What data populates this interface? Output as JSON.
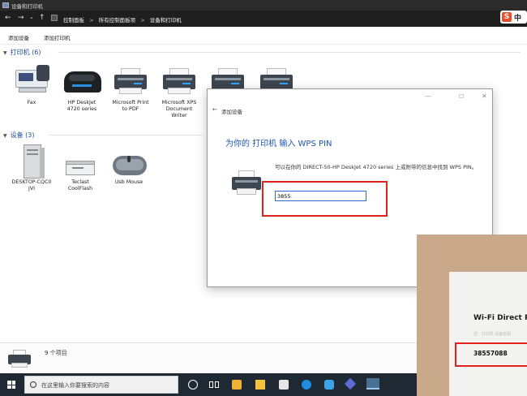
{
  "window": {
    "title": "设备和打印机"
  },
  "address": {
    "back": "←",
    "forward": "→",
    "dropdown": "⌄",
    "up": "↑",
    "crumbs": [
      "控制面板",
      "所有控制面板项",
      "设备和打印机"
    ],
    "sep": ">"
  },
  "ime": {
    "logo": "S",
    "mode": "中"
  },
  "toolbar": {
    "add_device": "添加设备",
    "add_printer": "添加打印机"
  },
  "groups": {
    "printers": {
      "label": "打印机 (6)"
    },
    "devices": {
      "label": "设备 (3)"
    }
  },
  "printers": [
    {
      "label": "Fax"
    },
    {
      "label": "HP DeskJet\n4720 series"
    },
    {
      "label": "Microsoft Print\nto PDF"
    },
    {
      "label": "Microsoft XPS\nDocument\nWriter"
    }
  ],
  "devices": [
    {
      "label": "DESKTOP-CQC0\nJVI"
    },
    {
      "label": "Teclast\nCoolFlash"
    },
    {
      "label": "Usb Mouse"
    }
  ],
  "status": {
    "count": "9 个项目"
  },
  "taskbar": {
    "search_placeholder": "在这里输入你要搜索的内容"
  },
  "dialog": {
    "title": "添加设备",
    "back": "←",
    "minimize": "—",
    "maximize": "☐",
    "close": "✕",
    "heading": "为你的 打印机 输入 WPS PIN",
    "description": "可以在你的 DIRECT-50-HP DeskJet 4720 series 上或附带的信息中找到 WPS PIN。",
    "pin_value": "3855"
  },
  "photo": {
    "title": "Wi-Fi Direct P",
    "subtitle": "送 · 打印机 设备密码",
    "pin": "38557088"
  },
  "colors": {
    "accent": "#1e55b0",
    "highlight": "#e1211c",
    "taskbar": "#1f2933"
  }
}
